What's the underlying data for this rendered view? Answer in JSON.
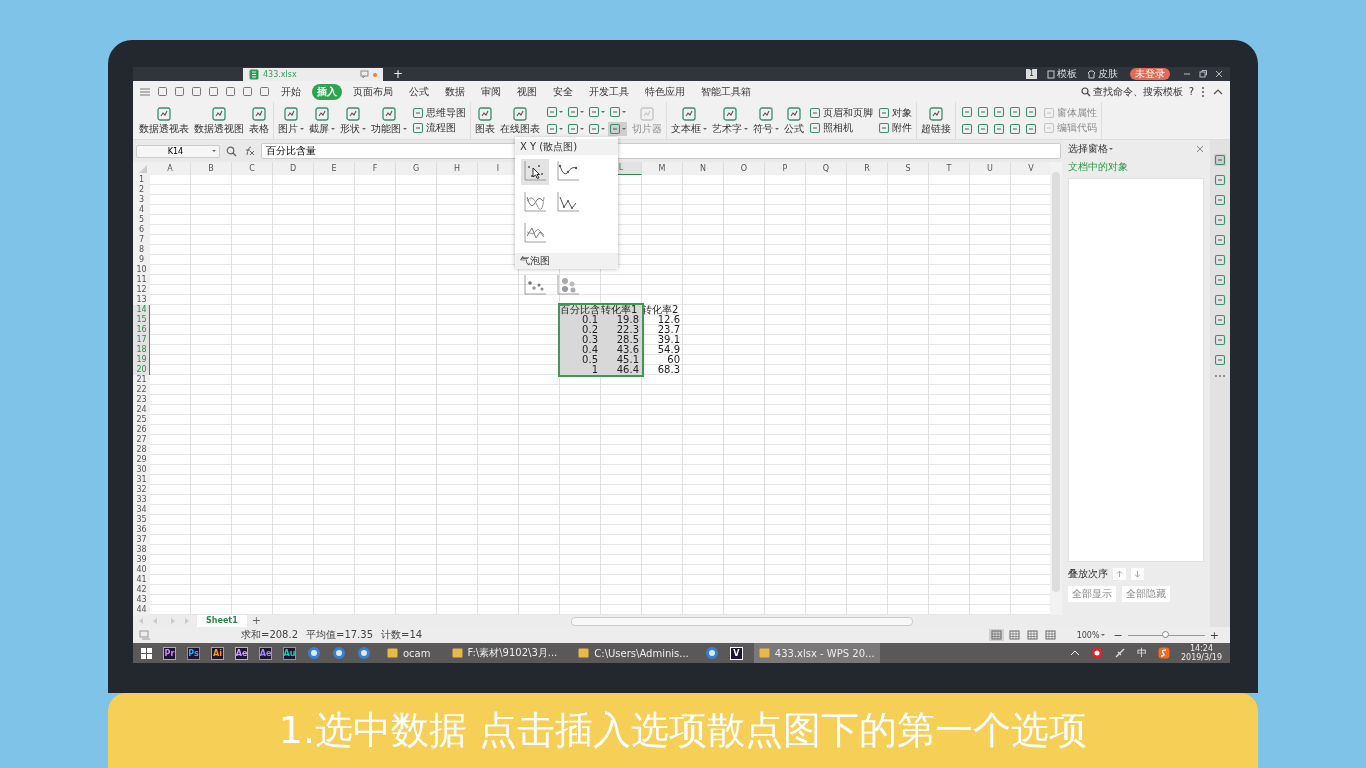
{
  "title_bar": {
    "tab": "433.xlsx",
    "unsaved": true,
    "new_tab": "+",
    "badge": "1",
    "template": "模板",
    "skin": "皮肤",
    "login": "未登录"
  },
  "menu": {
    "tabs": [
      {
        "label": "开始",
        "selected": false
      },
      {
        "label": "插入",
        "selected": true
      },
      {
        "label": "页面布局",
        "selected": false
      },
      {
        "label": "公式",
        "selected": false
      },
      {
        "label": "数据",
        "selected": false
      },
      {
        "label": "审阅",
        "selected": false
      },
      {
        "label": "视图",
        "selected": false
      },
      {
        "label": "安全",
        "selected": false
      },
      {
        "label": "开发工具",
        "selected": false
      },
      {
        "label": "特色应用",
        "selected": false
      },
      {
        "label": "智能工具箱",
        "selected": false
      }
    ],
    "search": "查找命令、搜索模板",
    "help": "?"
  },
  "ribbon": {
    "groups": [
      [
        {
          "kind": "large",
          "label": "数据透视表",
          "dropdown": false,
          "disabled": false
        },
        {
          "kind": "large",
          "label": "数据透视图",
          "dropdown": false,
          "disabled": false
        },
        {
          "kind": "large",
          "label": "表格",
          "dropdown": false,
          "disabled": false
        }
      ],
      [
        {
          "kind": "large",
          "label": "图片",
          "dropdown": true,
          "disabled": false
        },
        {
          "kind": "large",
          "label": "截屏",
          "dropdown": true,
          "disabled": false
        },
        {
          "kind": "large",
          "label": "形状",
          "dropdown": true,
          "disabled": false
        },
        {
          "kind": "large",
          "label": "功能图",
          "dropdown": true,
          "disabled": false
        },
        {
          "kind": "stack",
          "items": [
            {
              "label": "思维导图",
              "disabled": false
            },
            {
              "label": "流程图",
              "disabled": false
            }
          ]
        }
      ],
      [
        {
          "kind": "large",
          "label": "图表",
          "dropdown": false,
          "disabled": false
        },
        {
          "kind": "large",
          "label": "在线图表",
          "dropdown": false,
          "disabled": false
        },
        {
          "kind": "icon-grid",
          "icons": [
            {
              "dropdown": true,
              "selected": false
            },
            {
              "dropdown": true,
              "selected": false
            },
            {
              "dropdown": true,
              "selected": false
            },
            {
              "dropdown": true,
              "selected": false
            },
            {
              "dropdown": true,
              "selected": false
            },
            {
              "dropdown": true,
              "selected": false
            },
            {
              "dropdown": true,
              "selected": false
            },
            {
              "dropdown": true,
              "selected": true
            }
          ]
        },
        {
          "kind": "large",
          "label": "切片器",
          "dropdown": false,
          "disabled": true
        }
      ],
      [
        {
          "kind": "large",
          "label": "文本框",
          "dropdown": true,
          "disabled": false
        },
        {
          "kind": "large",
          "label": "艺术字",
          "dropdown": true,
          "disabled": false
        },
        {
          "kind": "large",
          "label": "符号",
          "dropdown": true,
          "disabled": false
        },
        {
          "kind": "large",
          "label": "公式",
          "dropdown": false,
          "disabled": false
        },
        {
          "kind": "stack",
          "items": [
            {
              "label": "页眉和页脚",
              "disabled": false
            },
            {
              "label": "照相机",
              "disabled": false
            }
          ]
        },
        {
          "kind": "stack",
          "items": [
            {
              "label": "对象",
              "disabled": false
            },
            {
              "label": "附件",
              "disabled": false
            }
          ]
        }
      ],
      [
        {
          "kind": "large",
          "label": "超链接",
          "dropdown": false,
          "disabled": false
        }
      ],
      [
        {
          "kind": "icon-grid",
          "icons": [
            {
              "dropdown": false,
              "selected": false
            },
            {
              "dropdown": false,
              "selected": false
            },
            {
              "dropdown": false,
              "selected": false
            },
            {
              "dropdown": false,
              "selected": false
            },
            {
              "dropdown": false,
              "selected": false
            },
            {
              "dropdown": false,
              "selected": false
            },
            {
              "dropdown": false,
              "selected": false
            },
            {
              "dropdown": false,
              "selected": false
            },
            {
              "dropdown": false,
              "selected": false
            },
            {
              "dropdown": false,
              "selected": false
            }
          ]
        },
        {
          "kind": "stack",
          "items": [
            {
              "label": "窗体属性",
              "disabled": true
            },
            {
              "label": "编辑代码",
              "disabled": true
            }
          ]
        }
      ]
    ]
  },
  "formula_bar": {
    "name_box": "K14",
    "formula": "百分比含量"
  },
  "chart_menu": {
    "sections": [
      {
        "title": "X Y (散点图)",
        "charts": [
          {
            "kind": "scatter",
            "selected": true
          },
          {
            "kind": "smooth-markers",
            "selected": false
          },
          {
            "kind": "smooth",
            "selected": false
          },
          {
            "kind": "line-markers",
            "selected": false
          },
          {
            "kind": "line",
            "selected": false
          }
        ]
      },
      {
        "title": "气泡图",
        "charts": [
          {
            "kind": "bubble",
            "selected": false
          },
          {
            "kind": "bubble-3d",
            "selected": false
          }
        ]
      }
    ]
  },
  "sheet": {
    "columns": [
      {
        "label": "A",
        "selected": false
      },
      {
        "label": "B",
        "selected": false
      },
      {
        "label": "C",
        "selected": false
      },
      {
        "label": "D",
        "selected": false
      },
      {
        "label": "E",
        "selected": false
      },
      {
        "label": "F",
        "selected": false
      },
      {
        "label": "G",
        "selected": false
      },
      {
        "label": "H",
        "selected": false
      },
      {
        "label": "I",
        "selected": false
      },
      {},
      {},
      {
        "label": "L",
        "selected": true
      },
      {
        "label": "M",
        "selected": false
      },
      {
        "label": "N",
        "selected": false
      },
      {
        "label": "O",
        "selected": false
      },
      {
        "label": "P",
        "selected": false
      },
      {
        "label": "Q",
        "selected": false
      },
      {
        "label": "R",
        "selected": false
      },
      {
        "label": "S",
        "selected": false
      },
      {
        "label": "T",
        "selected": false
      },
      {
        "label": "U",
        "selected": false
      },
      {
        "label": "V",
        "selected": false
      }
    ],
    "rows": [
      {
        "label": "1",
        "selected": false
      },
      {
        "label": "2",
        "selected": false
      },
      {
        "label": "3",
        "selected": false
      },
      {
        "label": "4",
        "selected": false
      },
      {
        "label": "5",
        "selected": false
      },
      {
        "label": "6",
        "selected": false
      },
      {
        "label": "7",
        "selected": false
      },
      {
        "label": "8",
        "selected": false
      },
      {
        "label": "9",
        "selected": false
      },
      {
        "label": "10",
        "selected": false
      },
      {
        "label": "11",
        "selected": false
      },
      {
        "label": "12",
        "selected": false
      },
      {
        "label": "13",
        "selected": false
      },
      {
        "label": "14",
        "selected": true,
        "cells": [
          {},
          {},
          {},
          {},
          {},
          {},
          {},
          {},
          {},
          {},
          {
            "text": "百分比含",
            "kind": "text",
            "selected": true
          },
          {
            "text": "转化率1",
            "kind": "text",
            "selected": true
          },
          {
            "text": "转化率2",
            "kind": "text",
            "selected": false
          }
        ]
      },
      {
        "label": "15",
        "selected": true,
        "cells": [
          {},
          {},
          {},
          {},
          {},
          {},
          {},
          {},
          {},
          {},
          {
            "text": "0.1",
            "kind": "number",
            "selected": true
          },
          {
            "text": "19.8",
            "kind": "number",
            "selected": true
          },
          {
            "text": "12.6",
            "kind": "number",
            "selected": false
          }
        ]
      },
      {
        "label": "16",
        "selected": true,
        "cells": [
          {},
          {},
          {},
          {},
          {},
          {},
          {},
          {},
          {},
          {},
          {
            "text": "0.2",
            "kind": "number",
            "selected": true
          },
          {
            "text": "22.3",
            "kind": "number",
            "selected": true
          },
          {
            "text": "23.7",
            "kind": "number",
            "selected": false
          }
        ]
      },
      {
        "label": "17",
        "selected": true,
        "cells": [
          {},
          {},
          {},
          {},
          {},
          {},
          {},
          {},
          {},
          {},
          {
            "text": "0.3",
            "kind": "number",
            "selected": true
          },
          {
            "text": "28.5",
            "kind": "number",
            "selected": true
          },
          {
            "text": "39.1",
            "kind": "number",
            "selected": false
          }
        ]
      },
      {
        "label": "18",
        "selected": true,
        "cells": [
          {},
          {},
          {},
          {},
          {},
          {},
          {},
          {},
          {},
          {},
          {
            "text": "0.4",
            "kind": "number",
            "selected": true
          },
          {
            "text": "43.6",
            "kind": "number",
            "selected": true
          },
          {
            "text": "54.9",
            "kind": "number",
            "selected": false
          }
        ]
      },
      {
        "label": "19",
        "selected": true,
        "cells": [
          {},
          {},
          {},
          {},
          {},
          {},
          {},
          {},
          {},
          {},
          {
            "text": "0.5",
            "kind": "number",
            "selected": true
          },
          {
            "text": "45.1",
            "kind": "number",
            "selected": true
          },
          {
            "text": "60",
            "kind": "number",
            "selected": false
          }
        ]
      },
      {
        "label": "20",
        "selected": true,
        "cells": [
          {},
          {},
          {},
          {},
          {},
          {},
          {},
          {},
          {},
          {},
          {
            "text": "1",
            "kind": "number",
            "selected": true
          },
          {
            "text": "46.4",
            "kind": "number",
            "selected": true
          },
          {
            "text": "68.3",
            "kind": "number",
            "selected": false
          }
        ]
      },
      {
        "label": "21",
        "selected": false
      },
      {
        "label": "22",
        "selected": false
      },
      {
        "label": "23",
        "selected": false
      },
      {
        "label": "24",
        "selected": false
      },
      {
        "label": "25",
        "selected": false
      },
      {
        "label": "26",
        "selected": false
      },
      {
        "label": "27",
        "selected": false
      },
      {
        "label": "28",
        "selected": false
      },
      {
        "label": "29",
        "selected": false
      },
      {
        "label": "30",
        "selected": false
      },
      {
        "label": "31",
        "selected": false
      },
      {
        "label": "32",
        "selected": false
      },
      {
        "label": "33",
        "selected": false
      },
      {
        "label": "34",
        "selected": false
      },
      {
        "label": "35",
        "selected": false
      },
      {
        "label": "36",
        "selected": false
      },
      {
        "label": "37",
        "selected": false
      },
      {
        "label": "38",
        "selected": false
      },
      {
        "label": "39",
        "selected": false
      },
      {
        "label": "40",
        "selected": false
      },
      {
        "label": "41",
        "selected": false
      },
      {
        "label": "42",
        "selected": false
      },
      {
        "label": "43",
        "selected": false
      },
      {
        "label": "44",
        "selected": false
      }
    ],
    "tabs": [
      {
        "label": "Sheet1",
        "selected": true
      }
    ],
    "add_sheet": "+"
  },
  "selection_pane": {
    "title": "选择窗格",
    "section": "文档中的对象",
    "order_label": "叠放次序",
    "buttons": [
      {
        "label": "全部显示",
        "disabled": true
      },
      {
        "label": "全部隐藏",
        "disabled": true
      }
    ]
  },
  "status_bar": {
    "stats": [
      "求和=208.2",
      "平均值=17.35",
      "计数=14"
    ],
    "views": [
      {
        "selected": true
      },
      {
        "selected": false
      },
      {
        "selected": false
      },
      {
        "selected": false
      }
    ],
    "zoom": "100%",
    "zoom_out": "−",
    "zoom_in": "+",
    "zoom_slider": {
      "level": 0.5
    }
  },
  "taskbar": {
    "items": [
      {
        "kind": "start"
      },
      {
        "kind": "app-tile",
        "label": "Pr",
        "color": "#e77cff"
      },
      {
        "kind": "app-tile",
        "label": "Ps",
        "color": "#31a8ff"
      },
      {
        "kind": "app-tile",
        "label": "Ai",
        "color": "#ff9a00"
      },
      {
        "kind": "app-tile",
        "label": "Ae",
        "color": "#c9a0ff"
      },
      {
        "kind": "app-tile",
        "label": "Ae",
        "color": "#9f8bff"
      },
      {
        "kind": "app-tile",
        "label": "Au",
        "color": "#00d9a7"
      },
      {
        "kind": "icon"
      },
      {
        "kind": "icon"
      },
      {
        "kind": "icon"
      },
      {
        "kind": "window",
        "label": "ocam",
        "selected": false
      },
      {
        "kind": "window",
        "label": "F:\\素材\\9102\\3月...",
        "selected": false
      },
      {
        "kind": "window",
        "label": "C:\\Users\\Adminis...",
        "selected": false
      },
      {
        "kind": "icon"
      },
      {
        "kind": "app-tile",
        "label": "V",
        "color": "#ffffff"
      },
      {
        "kind": "window",
        "label": "433.xlsx - WPS 20...",
        "selected": true
      }
    ],
    "ime": "中",
    "time": "14:24",
    "date": "2019/3/19"
  },
  "caption": "1.选中数据 点击插入选项散点图下的第一个选项"
}
